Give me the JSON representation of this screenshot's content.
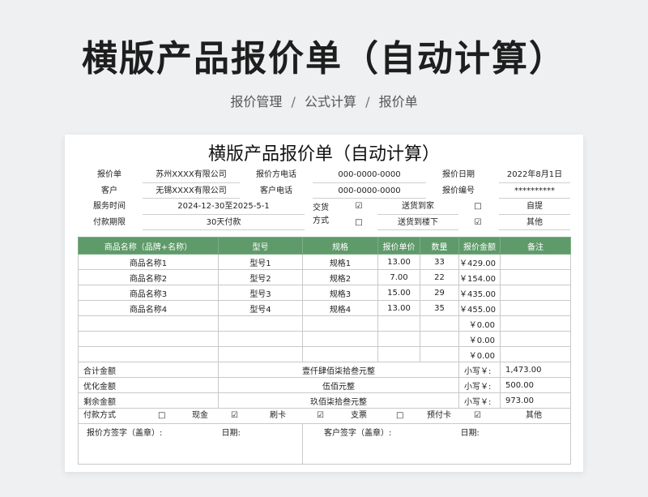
{
  "banner": {
    "title": "横版产品报价单（自动计算）"
  },
  "breadcrumb": {
    "items": [
      "报价管理",
      "公式计算",
      "报价单"
    ],
    "separator": "/"
  },
  "sheet": {
    "title": "横版产品报价单（自动计算）",
    "info": {
      "quote_unit_label": "报价单",
      "quote_unit_value": "苏州XXXX有限公司",
      "quote_phone_label": "报价方电话",
      "quote_phone_value": "000-0000-0000",
      "quote_date_label": "报价日期",
      "quote_date_value": "2022年8月1日",
      "customer_label": "客户",
      "customer_value": "无锡XXXX有限公司",
      "customer_phone_label": "客户电话",
      "customer_phone_value": "000-0000-0000",
      "quote_no_label": "报价编号",
      "quote_no_value": "**********",
      "service_time_label": "服务时间",
      "service_time_value": "2024-12-30至2025-5-1",
      "delivery_label_1": "交货",
      "delivery_label_2": "方式",
      "opt_door_label": "送货到家",
      "opt_self_label": "自提",
      "payment_term_label": "付款期限",
      "payment_term_value": "30天付款",
      "opt_floor_label": "送货到楼下",
      "opt_other_label": "其他",
      "checked_mark": "☑",
      "unchecked_mark": "□"
    },
    "table": {
      "headers": [
        "商品名称（品牌+名称）",
        "型号",
        "规格",
        "报价单价",
        "数量",
        "报价金额",
        "备注"
      ],
      "rows": [
        [
          "商品名称1",
          "型号1",
          "规格1",
          "13.00",
          "33",
          "￥429.00",
          ""
        ],
        [
          "商品名称2",
          "型号2",
          "规格2",
          "7.00",
          "22",
          "￥154.00",
          ""
        ],
        [
          "商品名称3",
          "型号3",
          "规格3",
          "15.00",
          "29",
          "￥435.00",
          ""
        ],
        [
          "商品名称4",
          "型号4",
          "规格4",
          "13.00",
          "35",
          "￥455.00",
          ""
        ],
        [
          "",
          "",
          "",
          "",
          "",
          "￥0.00",
          ""
        ],
        [
          "",
          "",
          "",
          "",
          "",
          "￥0.00",
          ""
        ],
        [
          "",
          "",
          "",
          "",
          "",
          "￥0.00",
          ""
        ]
      ]
    },
    "summary": {
      "total_label": "合计金额",
      "total_words": "壹仟肆佰柒拾叁元整",
      "total_small_label": "小写￥:",
      "total_small_value": "1,473.00",
      "discount_label": "优化金额",
      "discount_words": "伍佰元整",
      "discount_small_label": "小写￥:",
      "discount_small_value": "500.00",
      "remain_label": "剩余金额",
      "remain_words": "玖佰柒拾叁元整",
      "remain_small_label": "小写￥:",
      "remain_small_value": "973.00"
    },
    "payment": {
      "label": "付款方式",
      "cash": "现金",
      "card": "刷卡",
      "check": "支票",
      "prepaid": "预付卡",
      "other": "其他"
    },
    "signature": {
      "quoter_label": "报价方签字（盖章）:",
      "customer_label": "客户签字（盖章）:",
      "date_label": "日期:"
    }
  }
}
